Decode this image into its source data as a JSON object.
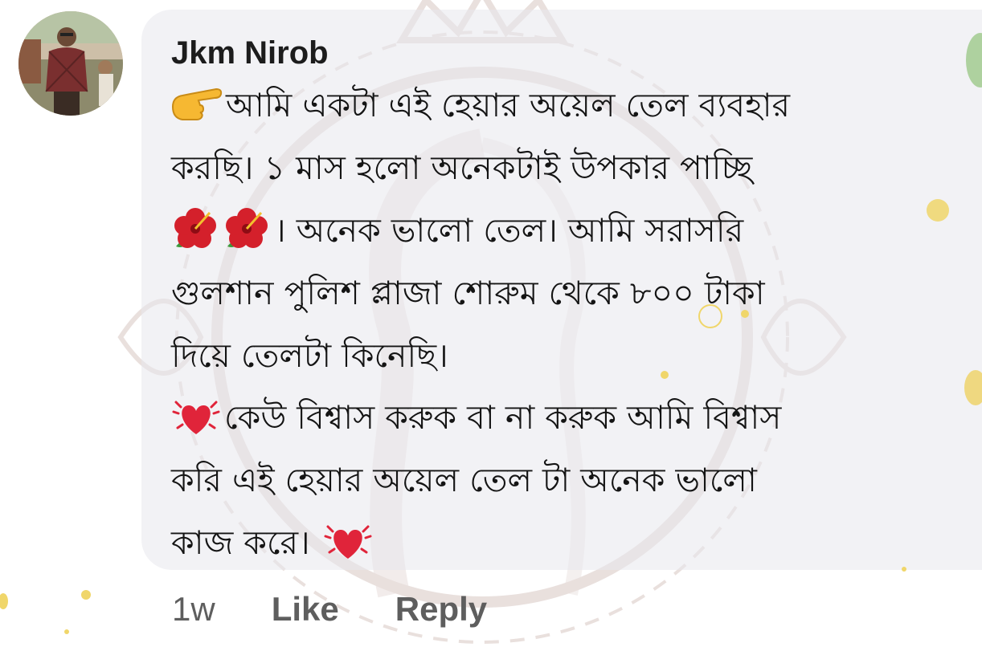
{
  "comment": {
    "author": "Jkm Nirob",
    "lines": [
      "আমি একটা এই হেয়ার অয়েল তেল  ব্যবহার",
      "করছি। ১ মাস হলো অনেকটাই উপকার পাচ্ছি",
      "। অনেক ভালো তেল। আমি সরাসরি",
      "গুলশান পুলিশ প্লাজা শোরুম থেকে ৮০০ টাকা",
      "দিয়ে তেলটা কিনেছি।",
      "কেউ বিশ্বাস করুক বা না করুক আমি বিশ্বাস",
      "করি এই হেয়ার অয়েল তেল টা অনেক ভালো",
      "কাজ করে।"
    ],
    "emojis": {
      "line1_prefix": "pointing-hand-icon",
      "line3_prefix": [
        "hibiscus-icon",
        "hibiscus-icon"
      ],
      "line6_prefix": "beating-heart-icon",
      "line8_suffix": "beating-heart-icon"
    }
  },
  "actions": {
    "time": "1w",
    "like_label": "Like",
    "reply_label": "Reply"
  },
  "colors": {
    "bubble": "#ececef",
    "text": "#141414",
    "footer": "#5e5e5e",
    "heart": "#e0243a",
    "hibiscus": "#d4202b",
    "hand": "#f6b832"
  }
}
